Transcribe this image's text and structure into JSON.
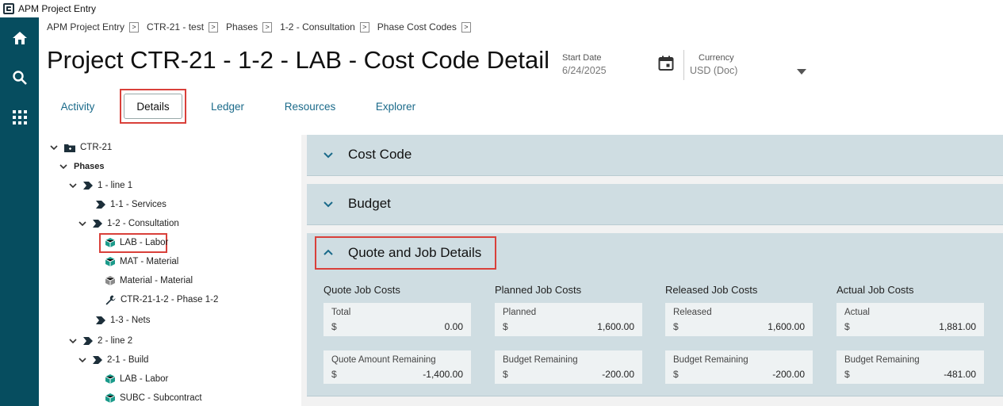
{
  "window": {
    "title": "APM Project Entry"
  },
  "breadcrumbs": [
    "APM Project Entry",
    "CTR-21 - test",
    "Phases",
    "1-2 - Consultation",
    "Phase Cost Codes"
  ],
  "page_title": "Project CTR-21 - 1-2 - LAB - Cost Code Detail",
  "fields": {
    "start_date_label": "Start Date",
    "start_date_value": "6/24/2025",
    "currency_label": "Currency",
    "currency_value": "USD (Doc)"
  },
  "tabs": [
    "Activity",
    "Details",
    "Ledger",
    "Resources",
    "Explorer"
  ],
  "active_tab": "Details",
  "tree": [
    {
      "label": "CTR-21",
      "icon": "folder-icon"
    },
    {
      "label": "Phases"
    },
    {
      "label": "1 - line 1",
      "icon": "phase-icon"
    },
    {
      "label": "1-1 - Services",
      "icon": "phase-icon"
    },
    {
      "label": "1-2 - Consultation",
      "icon": "phase-icon"
    },
    {
      "label": "LAB - Labor",
      "icon": "cube-icon"
    },
    {
      "label": "MAT - Material",
      "icon": "cube-icon"
    },
    {
      "label": "Material - Material",
      "icon": "cube-gray-icon"
    },
    {
      "label": "CTR-21-1-2 - Phase 1-2",
      "icon": "wrench-icon"
    },
    {
      "label": "1-3 - Nets",
      "icon": "phase-icon"
    },
    {
      "label": "2 - line 2",
      "icon": "phase-icon"
    },
    {
      "label": "2-1 - Build",
      "icon": "phase-icon"
    },
    {
      "label": "LAB - Labor",
      "icon": "cube-icon"
    },
    {
      "label": "SUBC - Subcontract",
      "icon": "cube-icon"
    }
  ],
  "sections": {
    "cost_code": "Cost Code",
    "budget": "Budget",
    "quote_job": "Quote and Job Details"
  },
  "columns": [
    {
      "title": "Quote Job Costs",
      "cards": [
        {
          "label": "Total",
          "currency": "$",
          "value": "0.00"
        },
        {
          "label": "Quote Amount Remaining",
          "currency": "$",
          "value": "-1,400.00"
        }
      ]
    },
    {
      "title": "Planned Job Costs",
      "cards": [
        {
          "label": "Planned",
          "currency": "$",
          "value": "1,600.00"
        },
        {
          "label": "Budget Remaining",
          "currency": "$",
          "value": "-200.00"
        }
      ]
    },
    {
      "title": "Released Job Costs",
      "cards": [
        {
          "label": "Released",
          "currency": "$",
          "value": "1,600.00"
        },
        {
          "label": "Budget Remaining",
          "currency": "$",
          "value": "-200.00"
        }
      ]
    },
    {
      "title": "Actual Job Costs",
      "cards": [
        {
          "label": "Actual",
          "currency": "$",
          "value": "1,881.00"
        },
        {
          "label": "Budget Remaining",
          "currency": "$",
          "value": "-481.00"
        }
      ]
    }
  ],
  "colors": {
    "nav": "#064d5f",
    "accent": "#1a6a8a",
    "highlight": "#d9403a",
    "section_bg": "#cfdde2",
    "teal_icon": "#1a9a8a"
  }
}
